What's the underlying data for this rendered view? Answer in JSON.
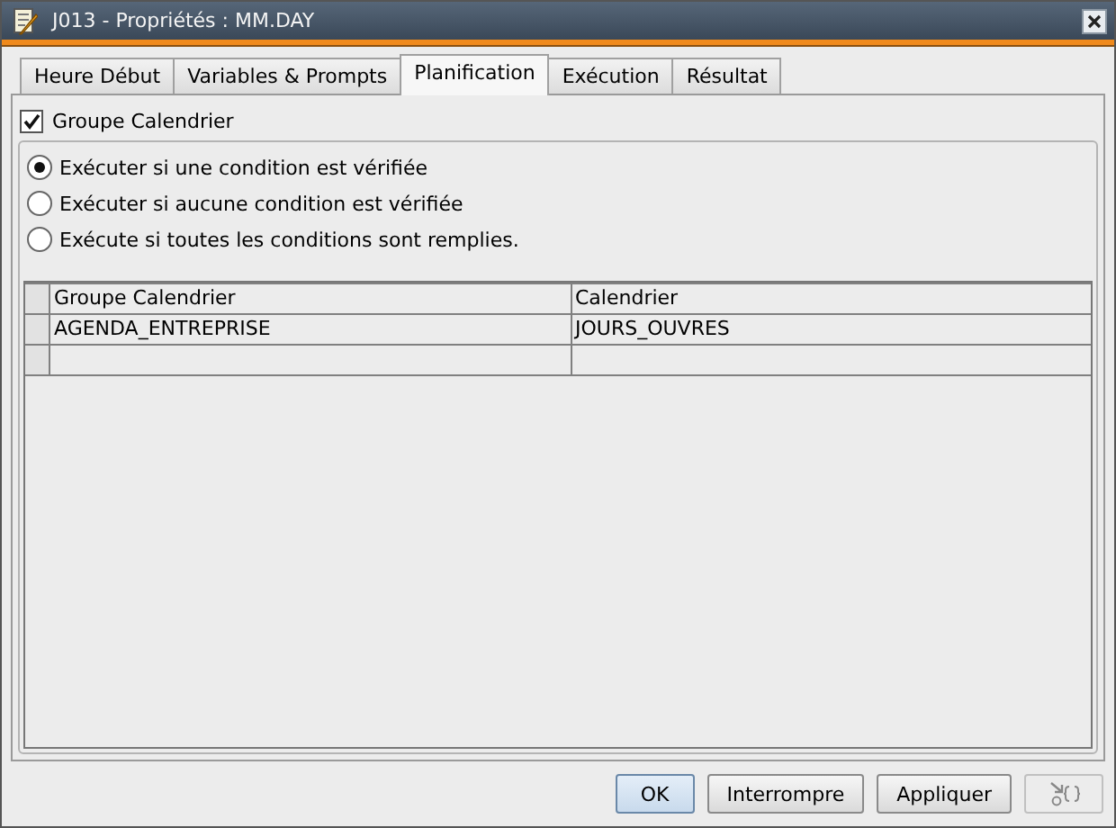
{
  "window": {
    "title": "J013 - Propriétés : MM.DAY"
  },
  "tabs": [
    {
      "label": "Heure Début",
      "selected": false
    },
    {
      "label": "Variables & Prompts",
      "selected": false
    },
    {
      "label": "Planification",
      "selected": true
    },
    {
      "label": "Exécution",
      "selected": false
    },
    {
      "label": "Résultat",
      "selected": false
    }
  ],
  "group_checkbox": {
    "label": "Groupe Calendrier",
    "checked": true
  },
  "conditions": [
    {
      "label": "Exécuter si une condition est vérifiée",
      "selected": true
    },
    {
      "label": "Exécuter si aucune condition est vérifiée",
      "selected": false
    },
    {
      "label": "Exécute si toutes les conditions sont remplies.",
      "selected": false
    }
  ],
  "table": {
    "columns": [
      "Groupe Calendrier",
      "Calendrier"
    ],
    "rows": [
      [
        "AGENDA_ENTREPRISE",
        "JOURS_OUVRES"
      ]
    ]
  },
  "buttons": [
    {
      "kind": "text",
      "label": "OK",
      "default": true,
      "disabled": false
    },
    {
      "kind": "text",
      "label": "Interrompre",
      "default": false,
      "disabled": false
    },
    {
      "kind": "text",
      "label": "Appliquer",
      "default": false,
      "disabled": false
    },
    {
      "kind": "icon",
      "default": false,
      "disabled": true
    }
  ]
}
